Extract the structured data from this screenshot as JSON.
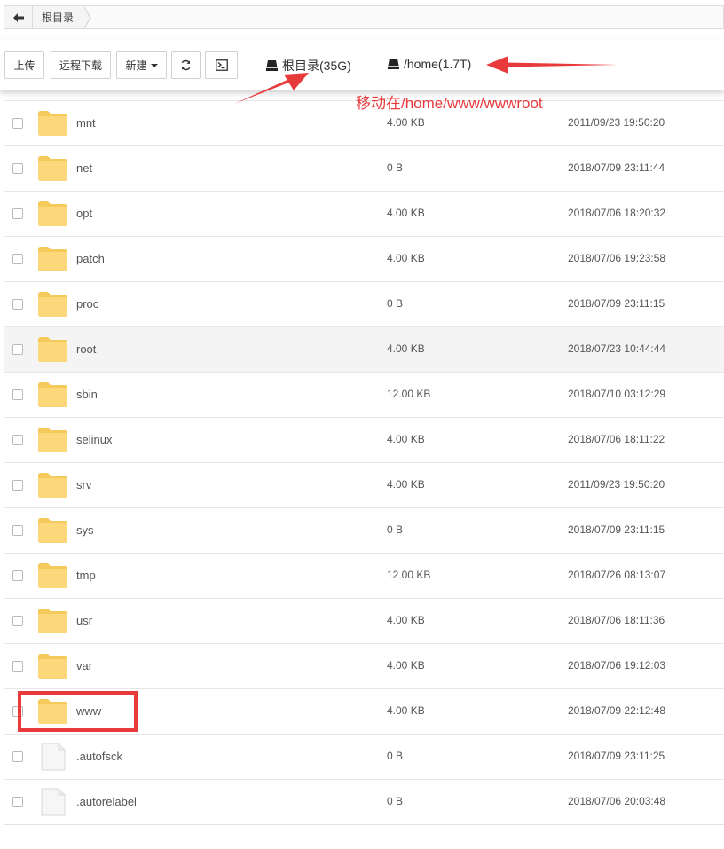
{
  "breadcrumb": {
    "items": [
      "根目录"
    ]
  },
  "toolbar": {
    "upload_label": "上传",
    "remote_download_label": "远程下载",
    "new_label": "新建",
    "disks": [
      {
        "label": "根目录(35G)"
      },
      {
        "label": "/home(1.7T)"
      }
    ]
  },
  "annotation": {
    "text": "移动在/home/www/wwwroot",
    "color": "#e8393b"
  },
  "colors": {
    "folder": "#fdd87a",
    "folder_dark": "#f5c95a",
    "accent_red": "#e8393b"
  },
  "files": [
    {
      "name": "mnt",
      "type": "folder",
      "size": "4.00 KB",
      "date": "2011/09/23 19:50:20"
    },
    {
      "name": "net",
      "type": "folder",
      "size": "0 B",
      "date": "2018/07/09 23:11:44"
    },
    {
      "name": "opt",
      "type": "folder",
      "size": "4.00 KB",
      "date": "2018/07/06 18:20:32"
    },
    {
      "name": "patch",
      "type": "folder",
      "size": "4.00 KB",
      "date": "2018/07/06 19:23:58"
    },
    {
      "name": "proc",
      "type": "folder",
      "size": "0 B",
      "date": "2018/07/09 23:11:15"
    },
    {
      "name": "root",
      "type": "folder",
      "size": "4.00 KB",
      "date": "2018/07/23 10:44:44",
      "highlighted": true
    },
    {
      "name": "sbin",
      "type": "folder",
      "size": "12.00 KB",
      "date": "2018/07/10 03:12:29"
    },
    {
      "name": "selinux",
      "type": "folder",
      "size": "4.00 KB",
      "date": "2018/07/06 18:11:22"
    },
    {
      "name": "srv",
      "type": "folder",
      "size": "4.00 KB",
      "date": "2011/09/23 19:50:20"
    },
    {
      "name": "sys",
      "type": "folder",
      "size": "0 B",
      "date": "2018/07/09 23:11:15"
    },
    {
      "name": "tmp",
      "type": "folder",
      "size": "12.00 KB",
      "date": "2018/07/26 08:13:07"
    },
    {
      "name": "usr",
      "type": "folder",
      "size": "4.00 KB",
      "date": "2018/07/06 18:11:36"
    },
    {
      "name": "var",
      "type": "folder",
      "size": "4.00 KB",
      "date": "2018/07/06 19:12:03"
    },
    {
      "name": "www",
      "type": "folder",
      "size": "4.00 KB",
      "date": "2018/07/09 22:12:48",
      "boxed": true
    },
    {
      "name": ".autofsck",
      "type": "file",
      "size": "0 B",
      "date": "2018/07/09 23:11:25"
    },
    {
      "name": ".autorelabel",
      "type": "file",
      "size": "0 B",
      "date": "2018/07/06 20:03:48"
    }
  ]
}
